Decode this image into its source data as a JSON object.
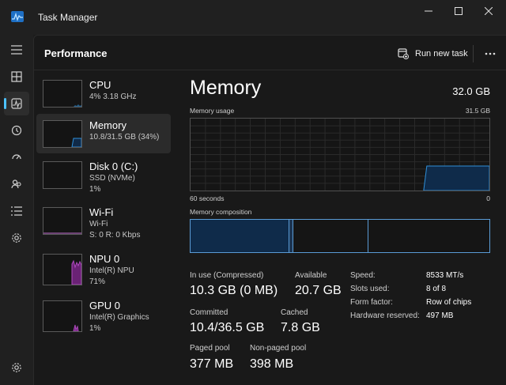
{
  "window": {
    "title": "Task Manager",
    "icons": {
      "app": "task-manager-icon",
      "minimize": "minimize-icon",
      "maximize": "maximize-icon",
      "close": "close-icon"
    }
  },
  "nav": {
    "items": [
      {
        "icon": "hamburger-menu-icon"
      },
      {
        "icon": "processes-icon"
      },
      {
        "icon": "performance-icon",
        "active": true
      },
      {
        "icon": "app-history-icon"
      },
      {
        "icon": "startup-apps-icon"
      },
      {
        "icon": "users-icon"
      },
      {
        "icon": "details-icon"
      },
      {
        "icon": "services-icon"
      },
      {
        "icon": "settings-icon"
      }
    ]
  },
  "header": {
    "title": "Performance",
    "run_new_task": "Run new task",
    "more_icon": "more-options-icon"
  },
  "resources": [
    {
      "name": "CPU",
      "line1": "4%  3.18 GHz",
      "line2": "",
      "graph_color": "#2f8fd8",
      "usage": 0.04
    },
    {
      "name": "Memory",
      "line1": "10.8/31.5 GB (34%)",
      "line2": "",
      "graph_color": "#2f8fd8",
      "usage": 0.34,
      "active": true
    },
    {
      "name": "Disk 0 (C:)",
      "line1": "SSD (NVMe)",
      "line2": "1%",
      "graph_color": "#5fbf4a",
      "usage": 0.01
    },
    {
      "name": "Wi-Fi",
      "line1": "Wi-Fi",
      "line2": "S: 0  R: 0 Kbps",
      "graph_color": "#c56fd4",
      "usage": 0.0
    },
    {
      "name": "NPU 0",
      "line1": "Intel(R) NPU",
      "line2": "71%",
      "graph_color": "#b04ac0",
      "usage": 0.71
    },
    {
      "name": "GPU 0",
      "line1": "Intel(R) Graphics",
      "line2": "1%",
      "graph_color": "#b04ac0",
      "usage": 0.01
    }
  ],
  "memory": {
    "title": "Memory",
    "total": "32.0 GB",
    "usage_label": "Memory usage",
    "usage_max": "31.5 GB",
    "time_label": "60 seconds",
    "time_end": "0",
    "current_usage_fraction": 0.34,
    "composition_label": "Memory composition",
    "composition": [
      {
        "name": "in-use",
        "fraction": 0.33,
        "color": "#0f2b4a"
      },
      {
        "name": "modified",
        "fraction": 0.015,
        "color": "#1c3552"
      },
      {
        "name": "standby",
        "fraction": 0.25,
        "color": "#151515"
      },
      {
        "name": "free",
        "fraction": 0.405,
        "color": "#151515"
      }
    ],
    "stats": {
      "in_use_label": "In use (Compressed)",
      "in_use_value": "10.3 GB (0 MB)",
      "available_label": "Available",
      "available_value": "20.7 GB",
      "committed_label": "Committed",
      "committed_value": "10.4/36.5 GB",
      "cached_label": "Cached",
      "cached_value": "7.8 GB",
      "paged_label": "Paged pool",
      "paged_value": "377 MB",
      "nonpaged_label": "Non-paged pool",
      "nonpaged_value": "398 MB"
    },
    "props": [
      {
        "label": "Speed:",
        "value": "8533 MT/s"
      },
      {
        "label": "Slots used:",
        "value": "8 of 8"
      },
      {
        "label": "Form factor:",
        "value": "Row of chips"
      },
      {
        "label": "Hardware reserved:",
        "value": "497 MB"
      }
    ]
  }
}
